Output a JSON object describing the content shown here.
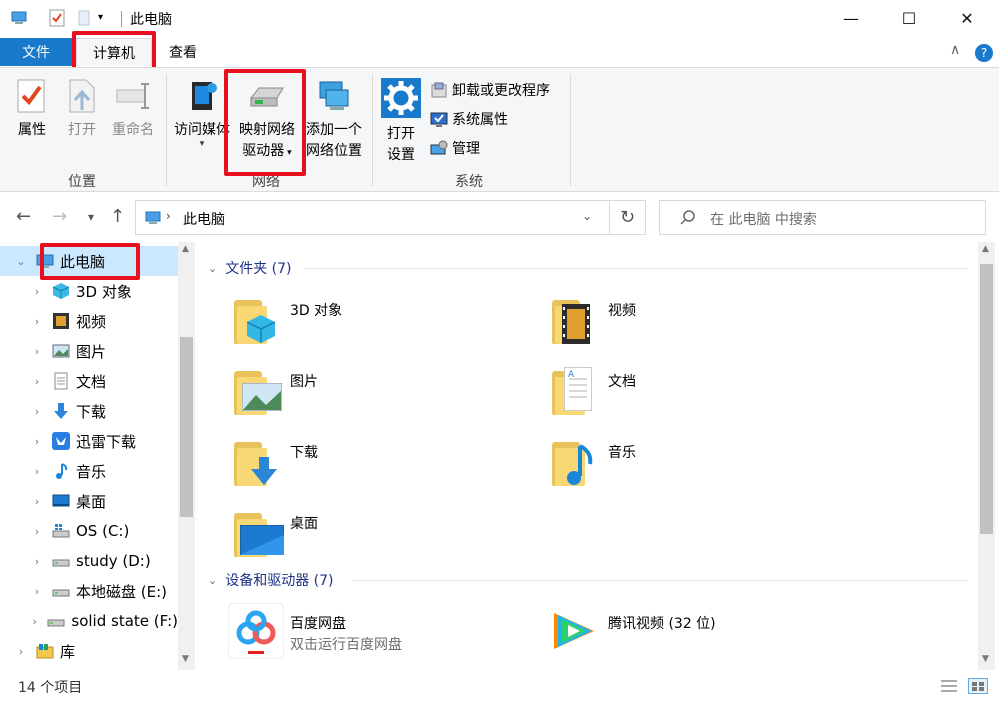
{
  "window": {
    "title": "此电脑",
    "minimize": "—",
    "maximize": "☐",
    "close": "✕"
  },
  "tabs": {
    "file": "文件",
    "computer": "计算机",
    "view": "查看",
    "collapse": "∧",
    "help": "?"
  },
  "ribbon": {
    "location": {
      "label": "位置",
      "properties": "属性",
      "open": "打开",
      "rename": "重命名"
    },
    "network": {
      "label": "网络",
      "access_media": "访问媒体",
      "map_drive_line1": "映射网络",
      "map_drive_line2": "驱动器",
      "add_location_line1": "添加一个",
      "add_location_line2": "网络位置"
    },
    "system": {
      "label": "系统",
      "open_settings_line1": "打开",
      "open_settings_line2": "设置",
      "uninstall": "卸载或更改程序",
      "system_properties": "系统属性",
      "manage": "管理"
    }
  },
  "address": {
    "path": "此电脑",
    "search_placeholder": "在 此电脑 中搜索"
  },
  "nav_tree": [
    {
      "label": "此电脑",
      "icon": "computer-icon"
    },
    {
      "label": "3D 对象",
      "icon": "3d-objects-icon"
    },
    {
      "label": "视频",
      "icon": "video-icon"
    },
    {
      "label": "图片",
      "icon": "pictures-icon"
    },
    {
      "label": "文档",
      "icon": "documents-icon"
    },
    {
      "label": "下载",
      "icon": "download-icon"
    },
    {
      "label": "迅雷下载",
      "icon": "xunlei-icon"
    },
    {
      "label": "音乐",
      "icon": "music-icon"
    },
    {
      "label": "桌面",
      "icon": "desktop-icon"
    },
    {
      "label": "OS (C:)",
      "icon": "drive-c-icon"
    },
    {
      "label": "study (D:)",
      "icon": "drive-icon"
    },
    {
      "label": "本地磁盘 (E:)",
      "icon": "drive-icon"
    },
    {
      "label": "solid state (F:)",
      "icon": "drive-icon"
    },
    {
      "label": "库",
      "icon": "library-icon"
    }
  ],
  "content": {
    "folders_header": "文件夹 (7)",
    "folders": [
      {
        "name": "3D 对象"
      },
      {
        "name": "视频"
      },
      {
        "name": "图片"
      },
      {
        "name": "文档"
      },
      {
        "name": "下载"
      },
      {
        "name": "音乐"
      },
      {
        "name": "桌面"
      }
    ],
    "devices_header": "设备和驱动器 (7)",
    "devices": [
      {
        "name": "百度网盘",
        "sub": "双击运行百度网盘"
      },
      {
        "name": "腾讯视频 (32 位)",
        "sub": ""
      }
    ]
  },
  "status": {
    "item_count": "14 个项目"
  },
  "colors": {
    "accent": "#1979ca",
    "highlight": "#e8101f",
    "selection": "#cce8ff",
    "folder": "#f8d775"
  }
}
